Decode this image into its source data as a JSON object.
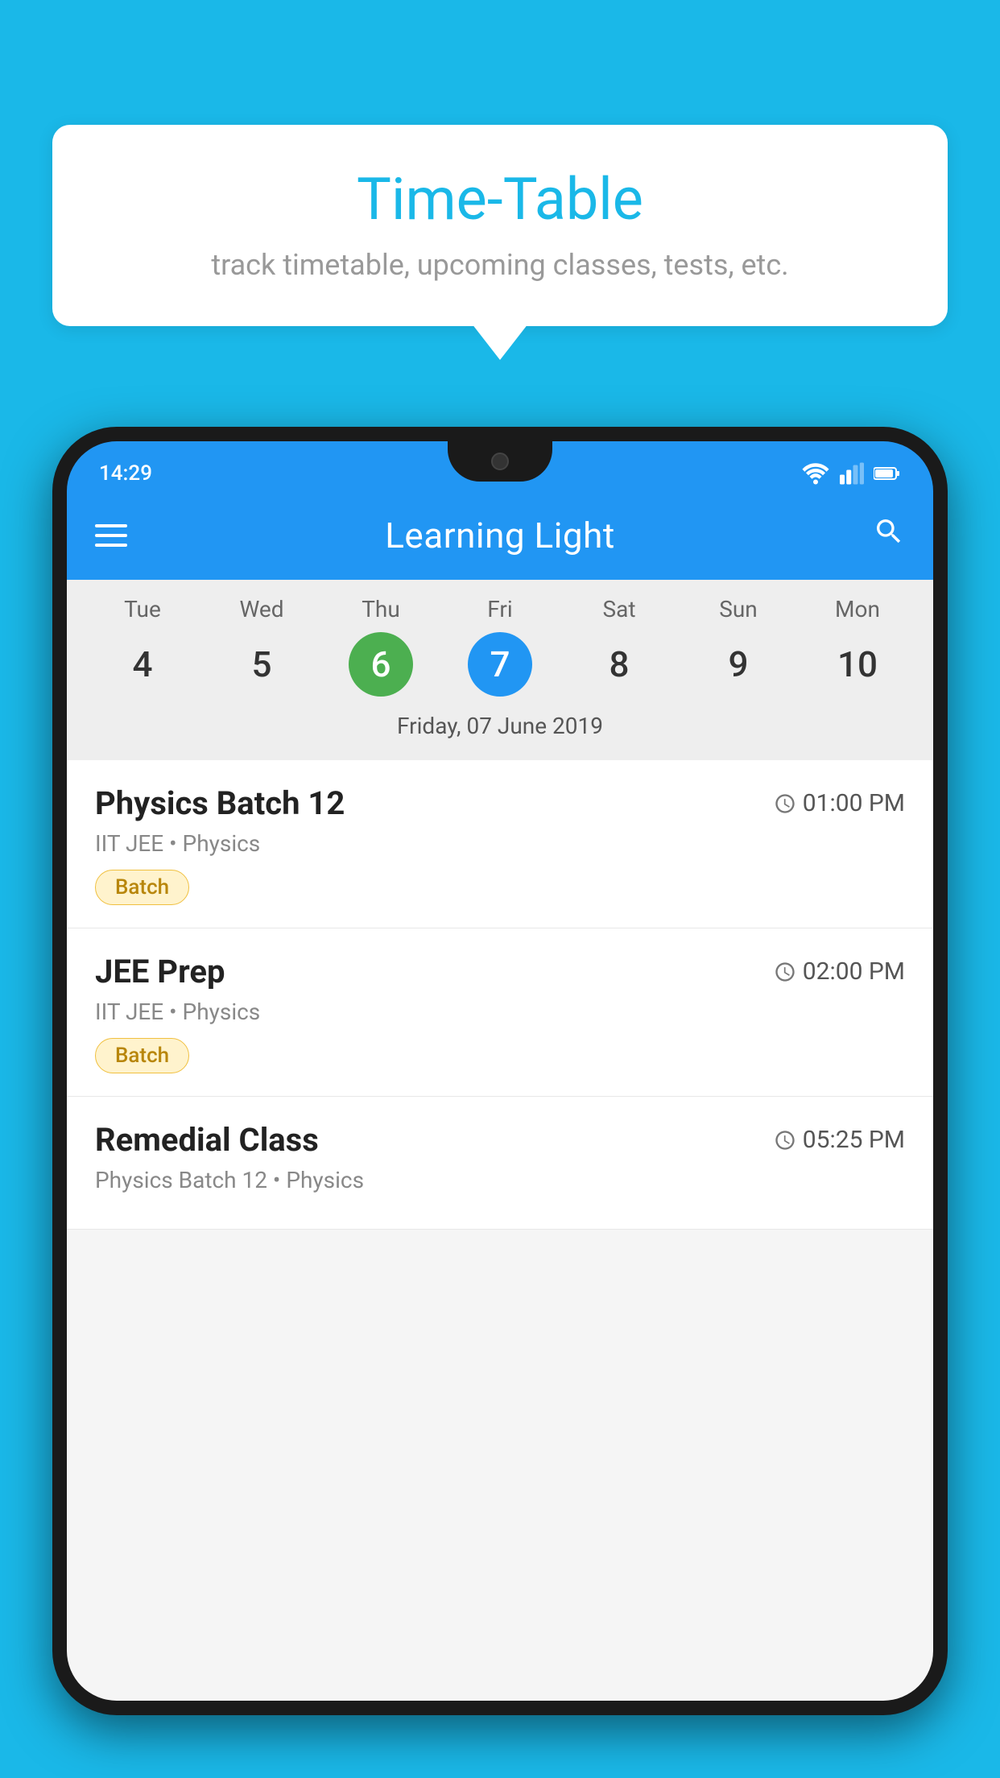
{
  "background_color": "#1AB8E8",
  "bubble": {
    "title": "Time-Table",
    "subtitle": "track timetable, upcoming classes, tests, etc."
  },
  "phone": {
    "status_time": "14:29",
    "app_name": "Learning Light",
    "calendar": {
      "days": [
        {
          "name": "Tue",
          "num": "4",
          "state": "normal"
        },
        {
          "name": "Wed",
          "num": "5",
          "state": "normal"
        },
        {
          "name": "Thu",
          "num": "6",
          "state": "today"
        },
        {
          "name": "Fri",
          "num": "7",
          "state": "selected"
        },
        {
          "name": "Sat",
          "num": "8",
          "state": "normal"
        },
        {
          "name": "Sun",
          "num": "9",
          "state": "normal"
        },
        {
          "name": "Mon",
          "num": "10",
          "state": "normal"
        }
      ],
      "selected_date_label": "Friday, 07 June 2019"
    },
    "schedule": [
      {
        "title": "Physics Batch 12",
        "time": "01:00 PM",
        "subtitle": "IIT JEE • Physics",
        "tag": "Batch"
      },
      {
        "title": "JEE Prep",
        "time": "02:00 PM",
        "subtitle": "IIT JEE • Physics",
        "tag": "Batch"
      },
      {
        "title": "Remedial Class",
        "time": "05:25 PM",
        "subtitle": "Physics Batch 12 • Physics",
        "tag": ""
      }
    ]
  }
}
